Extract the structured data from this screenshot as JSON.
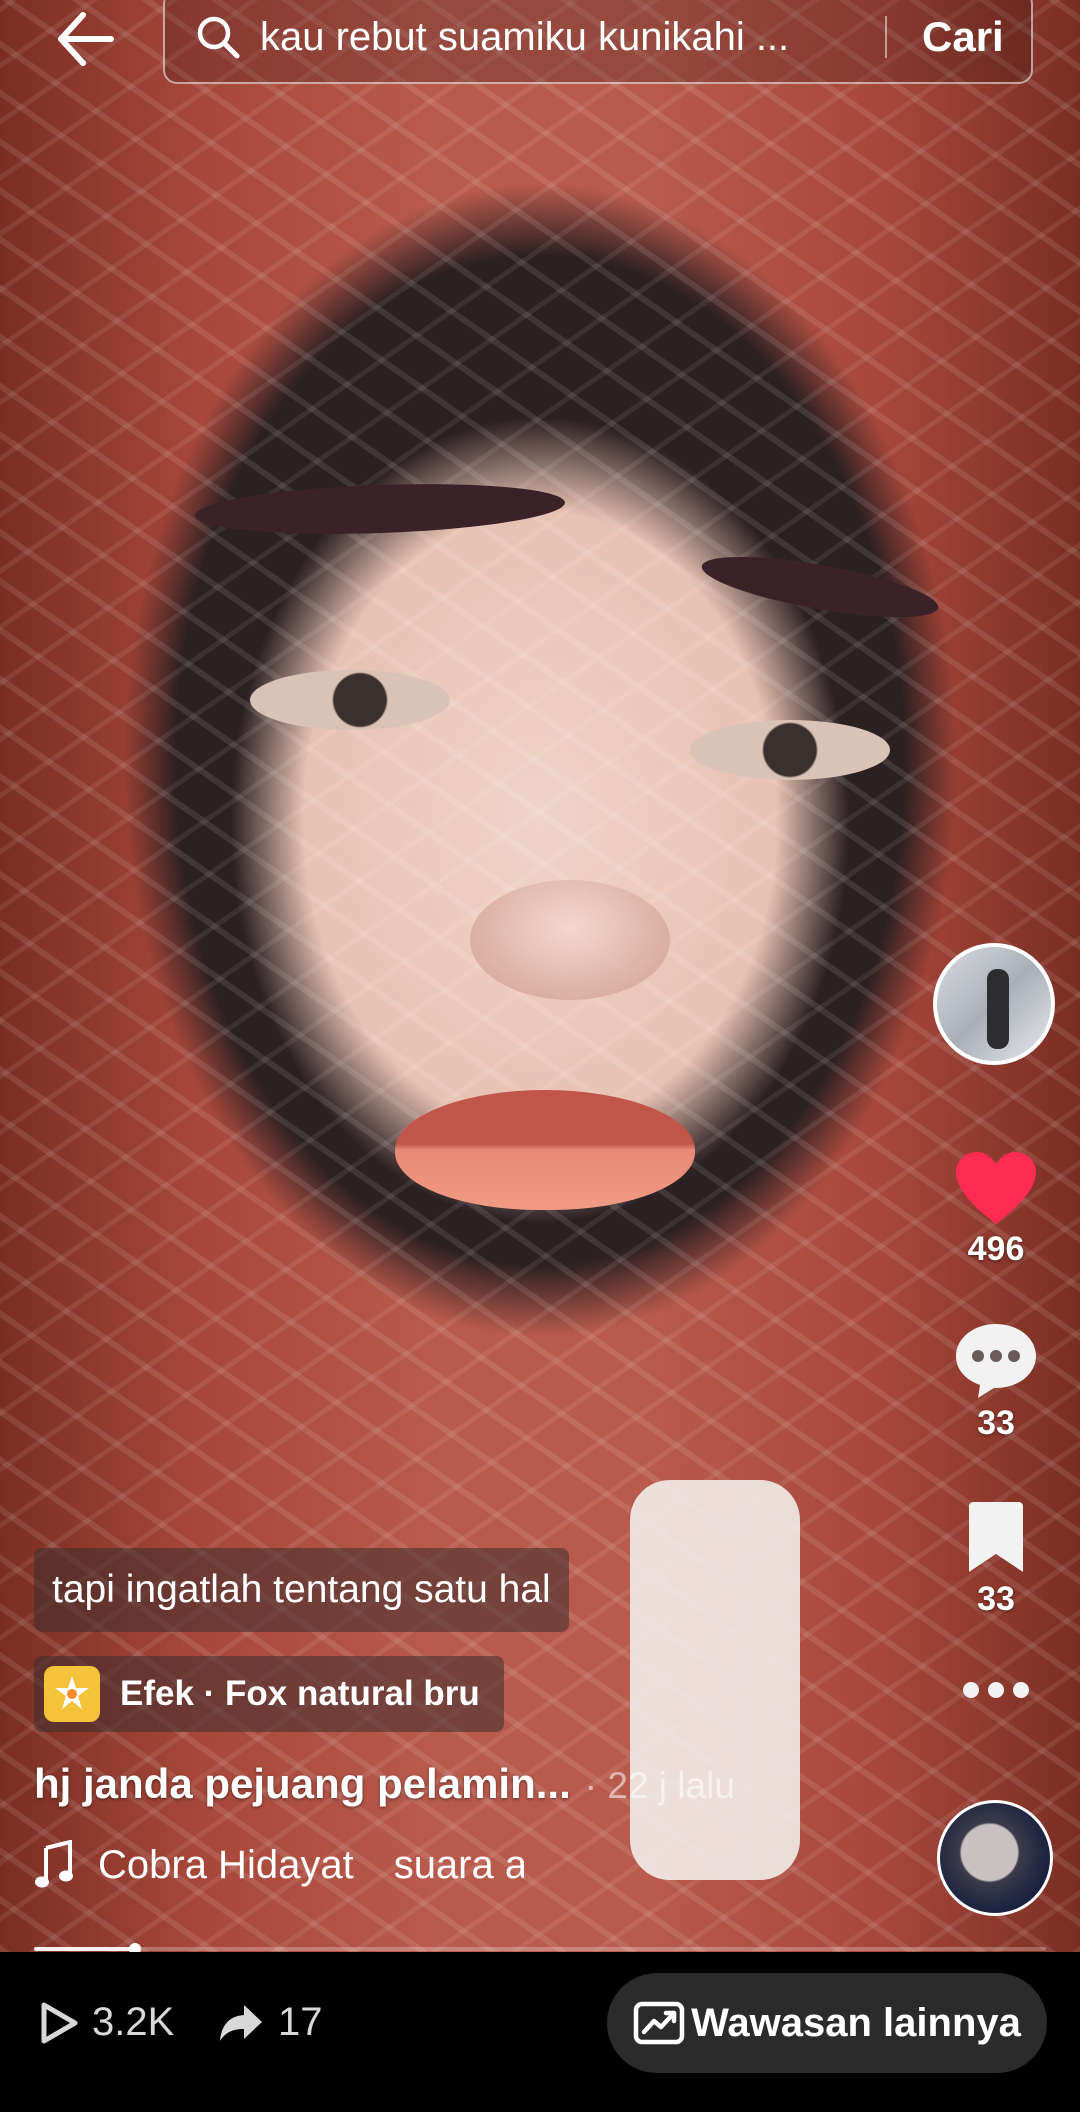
{
  "search": {
    "query": "kau rebut suamiku kunikahi ...",
    "submit_label": "Cari"
  },
  "video": {
    "subtitle": "tapi ingatlah tentang satu hal",
    "effect_label": "Efek · Fox natural bru",
    "username": "hj janda pejuang pelamin...",
    "posted": "· 22 j lalu",
    "music_author": "Cobra Hidayat",
    "music_sound": "suara a",
    "progress": 0.1
  },
  "actions": {
    "likes": "496",
    "comments": "33",
    "bookmarks": "33"
  },
  "bottom": {
    "views": "3.2K",
    "shares": "17",
    "insights_label": "Wawasan lainnya"
  },
  "colors": {
    "like": "#FE2C55",
    "effect_icon": "#F5C33A",
    "bottom_bar": "#000000",
    "insight_button": "#2B2B2B"
  },
  "icons": [
    "back-arrow-icon",
    "search-icon",
    "heart-icon",
    "comment-icon",
    "bookmark-icon",
    "more-icon",
    "effect-icon",
    "music-note-icon",
    "play-icon",
    "share-icon",
    "insight-chart-icon"
  ]
}
